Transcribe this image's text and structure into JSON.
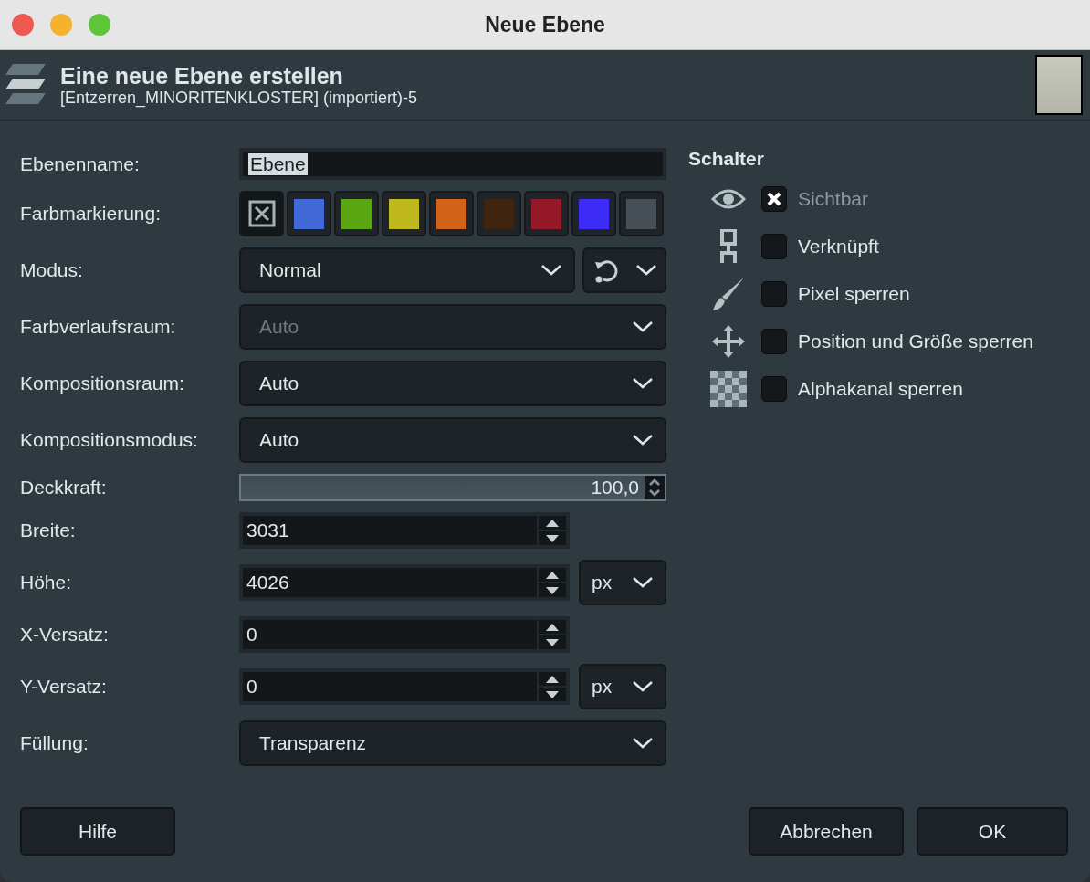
{
  "window": {
    "title": "Neue Ebene"
  },
  "header": {
    "title": "Eine neue Ebene erstellen",
    "subtitle": "[Entzerren_MINORITENKLOSTER] (importiert)-5"
  },
  "form": [
    {
      "kind": "text",
      "label": "Ebenenname:",
      "value": "Ebene"
    },
    {
      "kind": "colors",
      "label": "Farbmarkierung:",
      "swatches": [
        {
          "kind": "none",
          "selected": true
        },
        {
          "kind": "color",
          "color": "#4169d8",
          "selected": false
        },
        {
          "kind": "color",
          "color": "#5ba613",
          "selected": false
        },
        {
          "kind": "color",
          "color": "#bfb81f",
          "selected": false
        },
        {
          "kind": "color",
          "color": "#d26217",
          "selected": false
        },
        {
          "kind": "color",
          "color": "#3f2510",
          "selected": false
        },
        {
          "kind": "color",
          "color": "#961929",
          "selected": false
        },
        {
          "kind": "color",
          "color": "#3c2cf5",
          "selected": false
        },
        {
          "kind": "color",
          "color": "#474f57",
          "selected": false
        }
      ]
    },
    {
      "kind": "mode",
      "label": "Modus:",
      "value": "Normal"
    },
    {
      "kind": "dropdown",
      "label": "Farbverlaufsraum:",
      "value": "Auto",
      "disabled": true
    },
    {
      "kind": "dropdown",
      "label": "Kompositionsraum:",
      "value": "Auto",
      "disabled": false
    },
    {
      "kind": "dropdown",
      "label": "Kompositionsmodus:",
      "value": "Auto",
      "disabled": false
    },
    {
      "kind": "slider",
      "label": "Deckkraft:",
      "value": "100,0",
      "level": 1.0
    },
    {
      "kind": "spin",
      "label": "Breite:",
      "value": "3031"
    },
    {
      "kind": "spin",
      "label": "Höhe:",
      "value": "4026",
      "unit": "px"
    },
    {
      "kind": "spin",
      "label": "X-Versatz:",
      "value": "0"
    },
    {
      "kind": "spin",
      "label": "Y-Versatz:",
      "value": "0",
      "unit": "px"
    },
    {
      "kind": "dropdown",
      "label": "Füllung:",
      "value": "Transparenz",
      "disabled": false
    }
  ],
  "switches": {
    "title": "Schalter",
    "items": [
      {
        "kind": "eye",
        "label": "Sichtbar",
        "checked": true,
        "disabled": true
      },
      {
        "kind": "chain",
        "label": "Verknüpft",
        "checked": false,
        "disabled": false
      },
      {
        "kind": "brush",
        "label": "Pixel sperren",
        "checked": false,
        "disabled": false
      },
      {
        "kind": "move",
        "label": "Position und Größe sperren",
        "checked": false,
        "disabled": false
      },
      {
        "kind": "alpha",
        "label": "Alphakanal sperren",
        "checked": false,
        "disabled": false
      }
    ]
  },
  "buttons": {
    "left": [
      "Hilfe"
    ],
    "right": [
      "Abbrechen",
      "OK"
    ]
  }
}
